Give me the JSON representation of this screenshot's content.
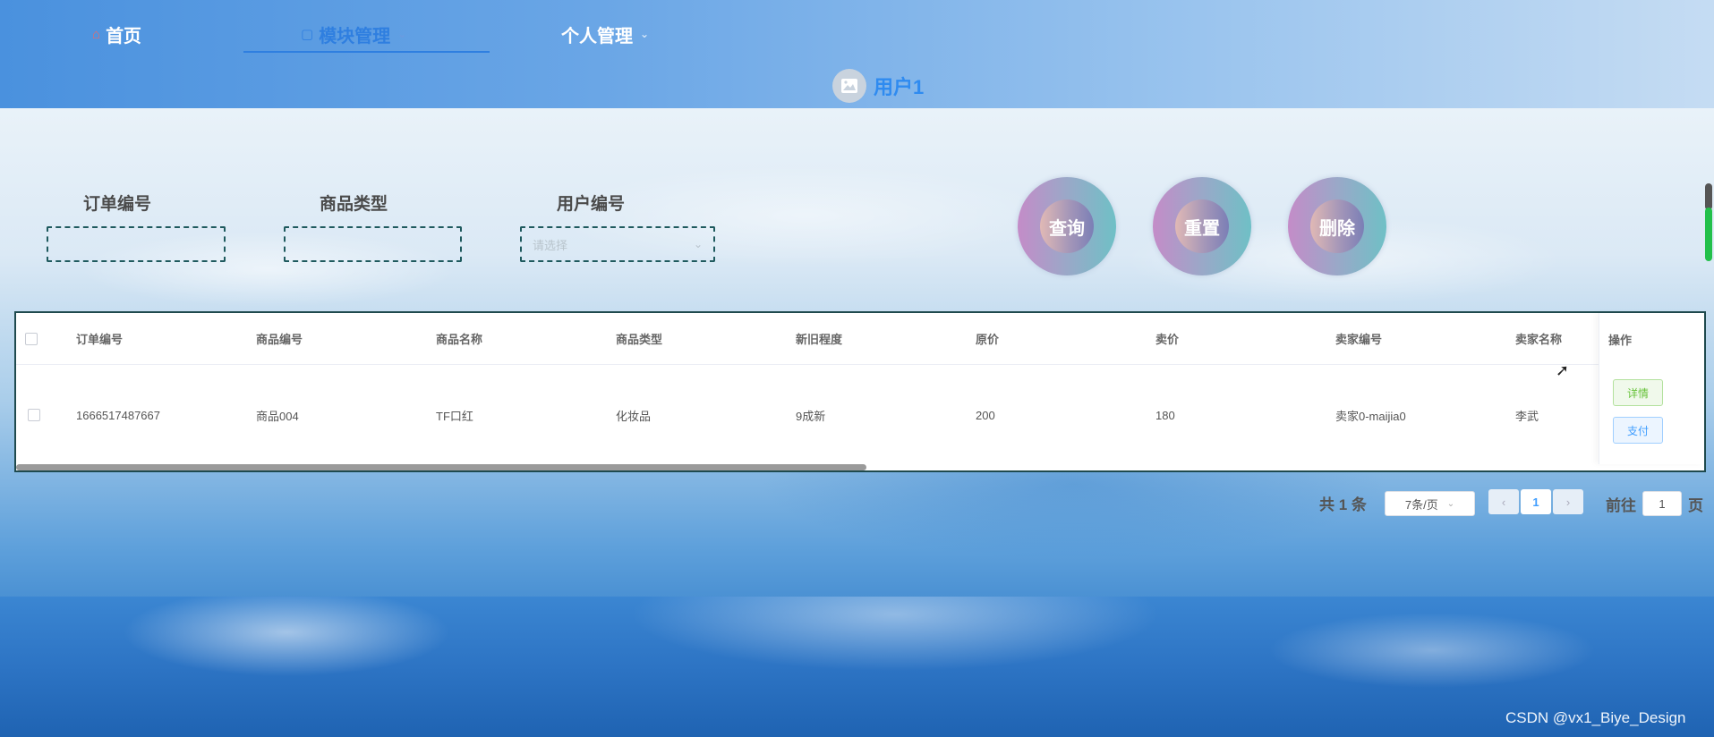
{
  "nav": {
    "home": "首页",
    "module": "模块管理",
    "personal": "个人管理"
  },
  "user": {
    "name": "用户1"
  },
  "search": {
    "order_label": "订单编号",
    "type_label": "商品类型",
    "user_label": "用户编号",
    "user_placeholder": "请选择",
    "query": "查询",
    "reset": "重置",
    "delete": "删除"
  },
  "table": {
    "headers": [
      "订单编号",
      "商品编号",
      "商品名称",
      "商品类型",
      "新旧程度",
      "原价",
      "卖价",
      "卖家编号",
      "卖家名称"
    ],
    "op_header": "操作",
    "rows": [
      [
        "1666517487667",
        "商品004",
        "TF口红",
        "化妆品",
        "9成新",
        "200",
        "180",
        "卖家0-maijia0",
        "李武"
      ]
    ],
    "detail_btn": "详情",
    "pay_btn": "支付"
  },
  "pagination": {
    "total": "共 1 条",
    "page_size": "7条/页",
    "current_page": "1",
    "goto": "前往",
    "goto_value": "1",
    "page_unit": "页"
  },
  "watermark": "CSDN @vx1_Biye_Design",
  "colors": {
    "accent": "#2f7fe0",
    "user_name": "#2f8bf0",
    "detail_green": "#67c23a",
    "pay_blue": "#409eff"
  }
}
